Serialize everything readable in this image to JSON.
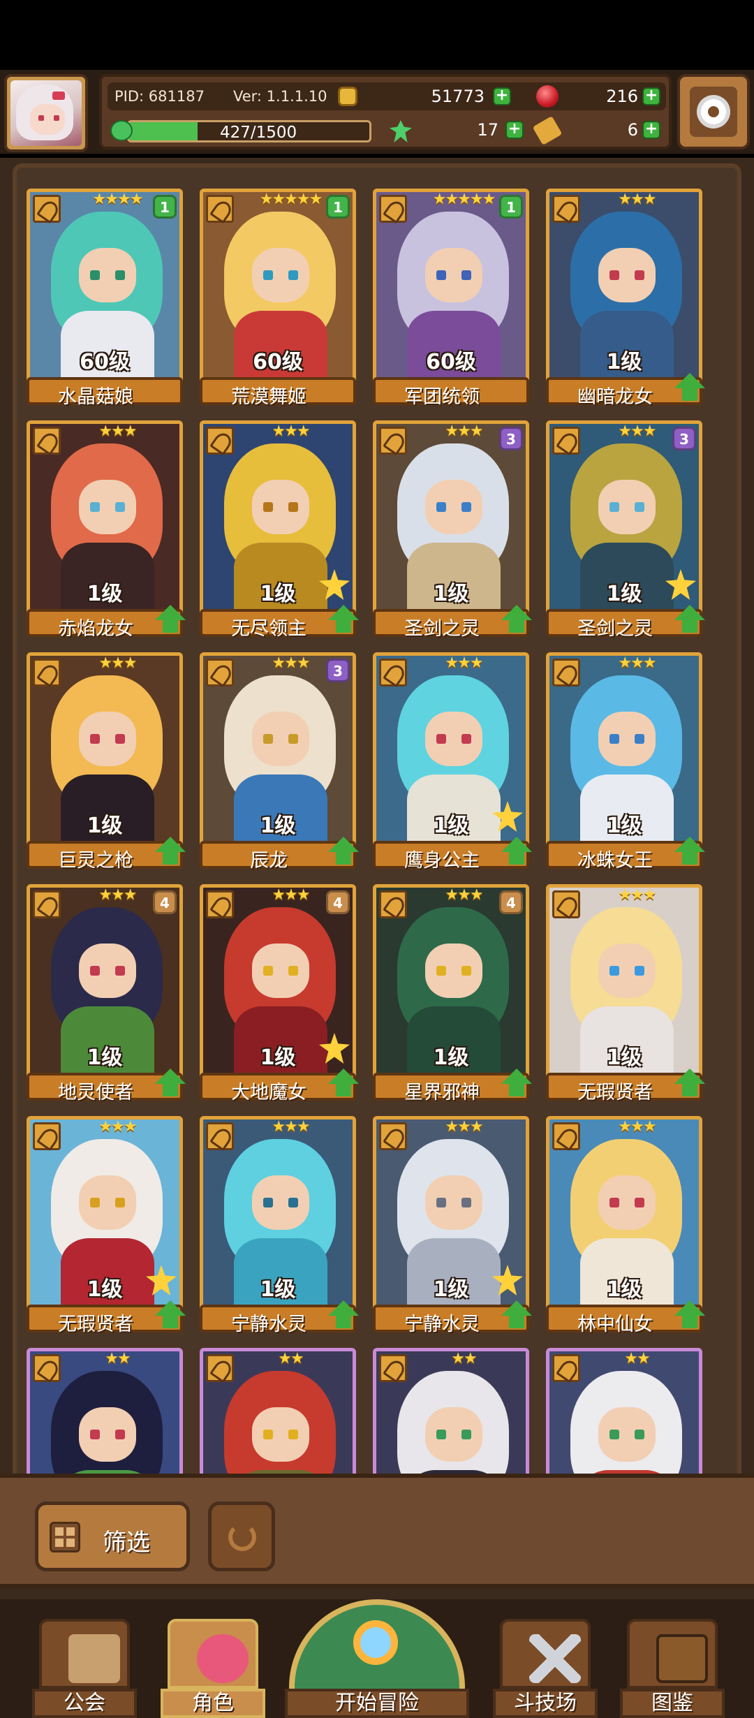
{
  "header": {
    "pid": "PID: 681187",
    "version": "Ver: 1.1.1.10",
    "coins": "51773",
    "gems": "216",
    "energy_text": "427/1500",
    "energy_fraction": 0.2847,
    "clovers": "17",
    "keys": "6"
  },
  "characters": [
    {
      "name": "水晶菇娘",
      "level": "60级",
      "stars": "★★★★",
      "badge": "1",
      "badge_color": "#43b44a",
      "hair": "#4fc7b7",
      "body": "#e9e9f0",
      "eye": "#2a8f6b",
      "bg": "#5a86a8",
      "upgrade": false,
      "fav": false
    },
    {
      "name": "荒漠舞姬",
      "level": "60级",
      "stars": "★★★★★",
      "badge": "1",
      "badge_color": "#43b44a",
      "hair": "#f3c964",
      "body": "#c93a36",
      "eye": "#2f9ac0",
      "bg": "#8a5a32",
      "upgrade": false,
      "fav": false
    },
    {
      "name": "军团统领",
      "level": "60级",
      "stars": "★★★★★",
      "badge": "1",
      "badge_color": "#43b44a",
      "hair": "#c8c2df",
      "body": "#7b4c9a",
      "eye": "#3e63b8",
      "bg": "#6a5a8a",
      "upgrade": false,
      "fav": false
    },
    {
      "name": "幽暗龙女",
      "level": "1级",
      "stars": "★★★",
      "badge": "",
      "badge_color": "",
      "hair": "#2c6fa8",
      "body": "#355c8a",
      "eye": "#c23b4e",
      "bg": "#3b4d6b",
      "upgrade": true,
      "fav": false
    },
    {
      "name": "赤焰龙女",
      "level": "1级",
      "stars": "★★★",
      "badge": "",
      "badge_color": "",
      "hair": "#e06a4a",
      "body": "#3a2424",
      "eye": "#5ab0d2",
      "bg": "#4a2a24",
      "upgrade": true,
      "fav": false
    },
    {
      "name": "无尽领主",
      "level": "1级",
      "stars": "★★★",
      "badge": "",
      "badge_color": "",
      "hair": "#e7bd3c",
      "body": "#b88a20",
      "eye": "#b5761a",
      "bg": "#2d4570",
      "upgrade": true,
      "fav": true
    },
    {
      "name": "圣剑之灵",
      "level": "1级",
      "stars": "★★★",
      "badge": "3",
      "badge_color": "#8e5fc4",
      "hair": "#d9dfe8",
      "body": "#cdb68c",
      "eye": "#3b7fc8",
      "bg": "#5d4a38",
      "upgrade": true,
      "fav": false
    },
    {
      "name": "圣剑之灵",
      "level": "1级",
      "stars": "★★★",
      "badge": "3",
      "badge_color": "#8e5fc4",
      "hair": "#b9a440",
      "body": "#2c4a5a",
      "eye": "#5ab0d2",
      "bg": "#2f5a78",
      "upgrade": true,
      "fav": true
    },
    {
      "name": "巨灵之枪",
      "level": "1级",
      "stars": "★★★",
      "badge": "",
      "badge_color": "",
      "hair": "#f3b953",
      "body": "#2a1e26",
      "eye": "#c23b4e",
      "bg": "#5a3a24",
      "upgrade": true,
      "fav": false
    },
    {
      "name": "辰龙",
      "level": "1级",
      "stars": "★★★",
      "badge": "3",
      "badge_color": "#8e5fc4",
      "hair": "#ede0cc",
      "body": "#3a78b8",
      "eye": "#c79a2a",
      "bg": "#5d4a38",
      "upgrade": true,
      "fav": false
    },
    {
      "name": "鹰身公主",
      "level": "1级",
      "stars": "★★★",
      "badge": "",
      "badge_color": "",
      "hair": "#5fd3e0",
      "body": "#e6e2d6",
      "eye": "#c23b4e",
      "bg": "#3c6a8a",
      "upgrade": true,
      "fav": true
    },
    {
      "name": "冰蛛女王",
      "level": "1级",
      "stars": "★★★",
      "badge": "",
      "badge_color": "",
      "hair": "#5bb9e6",
      "body": "#e8ecf2",
      "eye": "#3b7fc8",
      "bg": "#3a6a88",
      "upgrade": true,
      "fav": false
    },
    {
      "name": "地灵使者",
      "level": "1级",
      "stars": "★★★",
      "badge": "4",
      "badge_color": "#c98d4c",
      "hair": "#2c2a4a",
      "body": "#4c8a3a",
      "eye": "#c23b4e",
      "bg": "#4a3020",
      "upgrade": true,
      "fav": false
    },
    {
      "name": "大地魔女",
      "level": "1级",
      "stars": "★★★",
      "badge": "4",
      "badge_color": "#c98d4c",
      "hair": "#c73a2e",
      "body": "#8a1e22",
      "eye": "#e0b020",
      "bg": "#3a2420",
      "upgrade": true,
      "fav": true
    },
    {
      "name": "星界邪神",
      "level": "1级",
      "stars": "★★★",
      "badge": "4",
      "badge_color": "#c98d4c",
      "hair": "#2e6a4a",
      "body": "#244a38",
      "eye": "#e0b020",
      "bg": "#2a3a30",
      "upgrade": true,
      "fav": false
    },
    {
      "name": "无瑕贤者",
      "level": "1级",
      "stars": "★★★",
      "badge": "",
      "badge_color": "",
      "hair": "#f6dc94",
      "body": "#e8e2e0",
      "eye": "#3b9ae0",
      "bg": "#d8cfc8",
      "upgrade": true,
      "fav": false
    },
    {
      "name": "无瑕贤者",
      "level": "1级",
      "stars": "★★★",
      "badge": "",
      "badge_color": "",
      "hair": "#f0ebe6",
      "body": "#b32632",
      "eye": "#d8a020",
      "bg": "#6ab4d8",
      "upgrade": true,
      "fav": true
    },
    {
      "name": "宁静水灵",
      "level": "1级",
      "stars": "★★★",
      "badge": "",
      "badge_color": "",
      "hair": "#5fd0e0",
      "body": "#3aa4c0",
      "eye": "#2a7090",
      "bg": "#3a5a78",
      "upgrade": true,
      "fav": false
    },
    {
      "name": "宁静水灵",
      "level": "1级",
      "stars": "★★★",
      "badge": "",
      "badge_color": "",
      "hair": "#dfe4ec",
      "body": "#a8b0c0",
      "eye": "#6a7080",
      "bg": "#4a5a70",
      "upgrade": true,
      "fav": true
    },
    {
      "name": "林中仙女",
      "level": "1级",
      "stars": "★★★",
      "badge": "",
      "badge_color": "",
      "hair": "#f3cf73",
      "body": "#f0e6d8",
      "eye": "#c23b4e",
      "bg": "#4a8ab8",
      "upgrade": true,
      "fav": false
    },
    {
      "name": "",
      "level": "",
      "stars": "★★",
      "badge": "",
      "badge_color": "",
      "hair": "#1e1e3e",
      "body": "#4a9a44",
      "eye": "#c23b4e",
      "bg": "#384a80",
      "upgrade": false,
      "fav": false,
      "rare": true
    },
    {
      "name": "",
      "level": "",
      "stars": "★★",
      "badge": "",
      "badge_color": "",
      "hair": "#c73a2e",
      "body": "#6a6a30",
      "eye": "#e0b020",
      "bg": "#3a3a58",
      "upgrade": false,
      "fav": false,
      "rare": true
    },
    {
      "name": "",
      "level": "",
      "stars": "★★",
      "badge": "",
      "badge_color": "",
      "hair": "#e8e6ea",
      "body": "#2a2a3a",
      "eye": "#3a9a5a",
      "bg": "#3a3a58",
      "upgrade": false,
      "fav": false,
      "rare": true
    },
    {
      "name": "",
      "level": "",
      "stars": "★★",
      "badge": "",
      "badge_color": "",
      "hair": "#ecebee",
      "body": "#c2382e",
      "eye": "#3a9a5a",
      "bg": "#404a70",
      "upgrade": false,
      "fav": false,
      "rare": true
    }
  ],
  "filter": {
    "label": "筛选"
  },
  "nav": {
    "guild": "公会",
    "characters": "角色",
    "adventure": "开始冒险",
    "arena": "斗技场",
    "codex": "图鉴"
  }
}
